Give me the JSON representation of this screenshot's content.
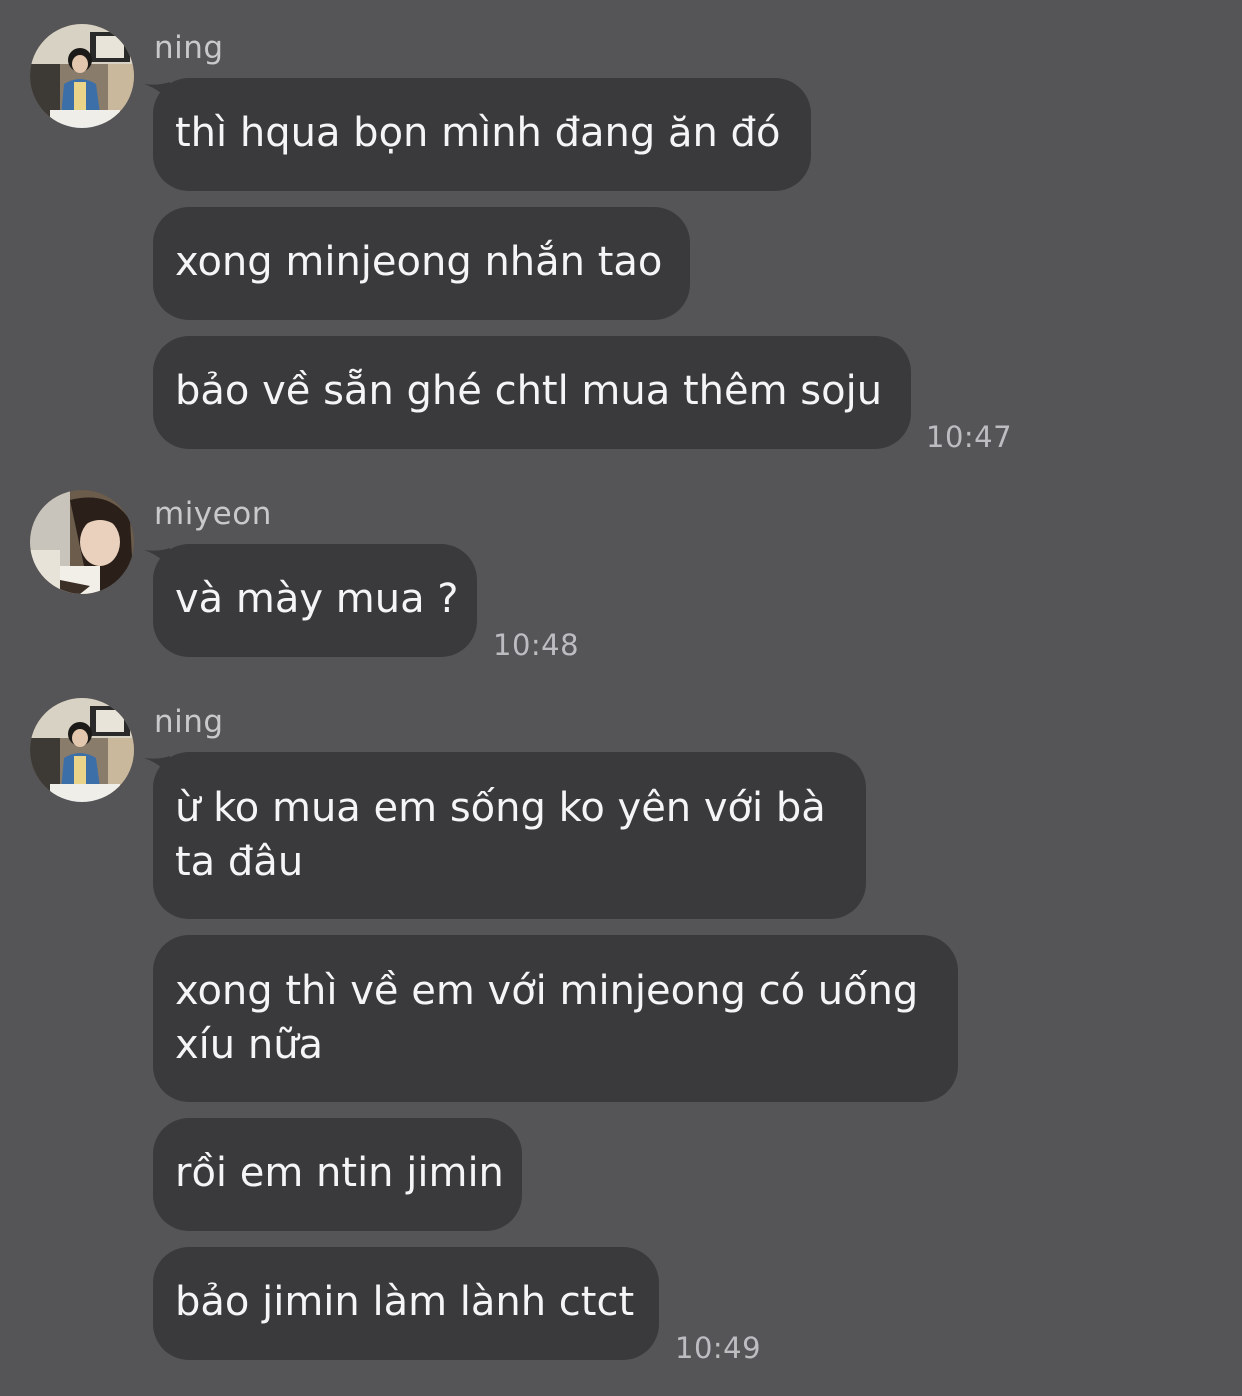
{
  "chat": {
    "groups": [
      {
        "sender": "ning",
        "messages": [
          "thì hqua bọn mình đang ăn đó",
          "xong minjeong nhắn tao",
          "bảo về sẵn ghé chtl mua thêm soju"
        ],
        "time": "10:47"
      },
      {
        "sender": "miyeon",
        "messages": [
          "và mày mua ?"
        ],
        "time": "10:48"
      },
      {
        "sender": "ning",
        "messages": [
          "ừ ko mua em sống ko yên với bà ta đâu",
          "xong thì về em với minjeong có uống xíu nữa",
          "rồi em ntin jimin",
          "bảo jimin làm lành ctct"
        ],
        "time": "10:49"
      }
    ]
  },
  "colors": {
    "background": "#555456",
    "bubble": "#3a393c",
    "bubble_text": "#f5f5f7",
    "meta_text": "#bdbcc0"
  },
  "icons": {
    "avatar_ning": "avatar-photo-ning",
    "avatar_miyeon": "avatar-photo-miyeon"
  }
}
